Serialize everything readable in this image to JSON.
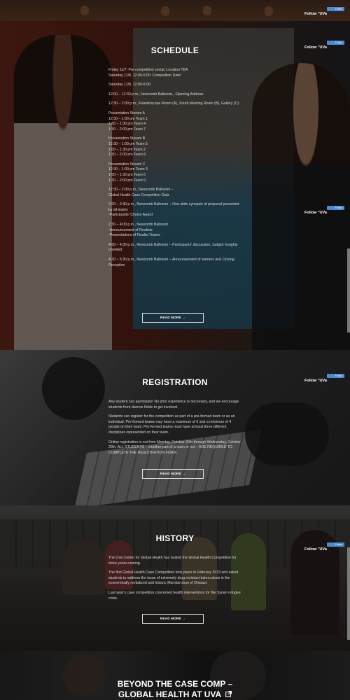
{
  "follow": {
    "chip": "Follow",
    "label": "Follow \"UVa"
  },
  "schedule": {
    "title": "SCHEDULE",
    "lines": [
      "Friday 11/7: Pre-competition social; Location TBA",
      "Saturday 11/8, 12:00-6:00: Competition Date!",
      "Saturday 11/8, 12:00-6:00:",
      "12:00 – 12:30 p.m., Newcomb Ballroom, -Opening Address",
      "12:30 – 2:00 p.m., Kaleidoscope Room (A), South Meeting Room (B), Gallery (C):",
      "Presentation Stream A",
      "12:30 – 1:00 pm Team 1",
      "1:00 – 1:30 pm Team 4",
      "1:30 – 2:00 pm Team 7",
      "Presentation Stream B",
      "12:30 – 1:00 pm Team 5",
      "1:00 – 1:30 pm Team 2",
      "1:30 – 2:00 pm Team 8",
      "Presentation Stream C",
      "12:30 – 1:00 pm Team 3",
      "1:00 – 1:30 pm Team 6",
      "1:30 – 2:00 pm Team 9",
      "12:30 – 2:00 p.m., Newcomb Ballroom –",
      "Global Health Case Competition Gala",
      "2:00 – 2:30 p.m., Newcomb Ballroom – One-slide synopsis of proposal presented by all teams",
      "-Participants' Choice Award",
      "2:30 – 4:00 p.m., Newcomb Ballroom",
      "-Announcement of Finalists",
      "-Presentations of Finalist Teams",
      "4:00 – 4:30 p.m., Newcomb Ballroom – Participants' discussion: Judges' insights unveiled",
      "4:30 – 5:30 p.m., Newcomb Ballroom – Announcement of winners and Closing Reception"
    ],
    "read_more": "READ MORE →"
  },
  "registration": {
    "title": "REGISTRATION",
    "paragraphs": [
      "Any student can participate! No prior experience is necessary, and we encourage students from diverse fields to get involved.",
      "Students can register for the competition as part of a pre-formed team or as an individual. Pre-formed teams may have a maximum of 6 and a minimum of 4 people on their team. Pre-formed teams must have at least three different disciplines represented on their team.",
      "Online registration is out from Monday, October 20th through Wednesday, October 29th. ALL STUDENTS – whether part of a team or not – ARE REQUIRED TO COMPLETE THE REGISTRATION FORM."
    ],
    "read_more": "READ MORE →"
  },
  "history": {
    "title": "HISTORY",
    "paragraphs": [
      "The UVa Center for Global Health has hosted the Global Health Competition for three years running.",
      "The first Global Health Case Competition took place in February 2013 and asked students to address the issue of extremely drug resistant tuberculosis in the economically revitalized and historic Mumbai slum of Dharavi.",
      "Last year's case competition concerned health interventions for the Syrian refugee crisis."
    ],
    "read_more": "READ MORE →"
  },
  "beyond": {
    "title_line1": "BEYOND THE CASE COMP –",
    "title_line2": "GLOBAL HEALTH AT UVA"
  },
  "colors": {
    "follow_blue": "#4a8bd0",
    "overlay": "rgba(0,0,0,0.45)"
  }
}
